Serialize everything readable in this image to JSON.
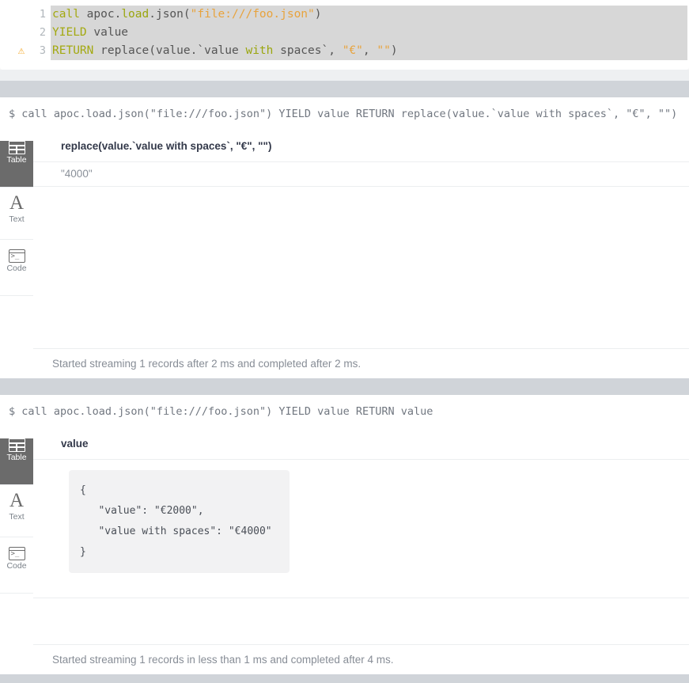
{
  "editor": {
    "lines": [
      {
        "number": "1",
        "warning": false,
        "tokens": [
          {
            "t": "call",
            "c": "kw"
          },
          {
            "t": " ",
            "c": "plain"
          },
          {
            "t": "apoc",
            "c": "plain"
          },
          {
            "t": ".",
            "c": "punct"
          },
          {
            "t": "load",
            "c": "kw2"
          },
          {
            "t": ".",
            "c": "punct"
          },
          {
            "t": "json",
            "c": "plain"
          },
          {
            "t": "(",
            "c": "punct"
          },
          {
            "t": "\"file:///foo.json\"",
            "c": "str"
          },
          {
            "t": ")",
            "c": "punct"
          }
        ]
      },
      {
        "number": "2",
        "warning": false,
        "tokens": [
          {
            "t": "YIELD",
            "c": "kw"
          },
          {
            "t": " value",
            "c": "plain"
          }
        ]
      },
      {
        "number": "3",
        "warning": true,
        "warning_icon": "warning-triangle-icon",
        "tokens": [
          {
            "t": "RETURN",
            "c": "kw"
          },
          {
            "t": " replace",
            "c": "plain"
          },
          {
            "t": "(",
            "c": "punct"
          },
          {
            "t": "value",
            "c": "plain"
          },
          {
            "t": ".",
            "c": "punct"
          },
          {
            "t": "`value ",
            "c": "plain"
          },
          {
            "t": "with",
            "c": "kw2"
          },
          {
            "t": " spaces`",
            "c": "plain"
          },
          {
            "t": ", ",
            "c": "punct"
          },
          {
            "t": "\"€\"",
            "c": "str"
          },
          {
            "t": ", ",
            "c": "punct"
          },
          {
            "t": "\"\"",
            "c": "str"
          },
          {
            "t": ")",
            "c": "punct"
          }
        ]
      }
    ]
  },
  "frames": [
    {
      "command": "$ call apoc.load.json(\"file:///foo.json\") YIELD value RETURN replace(value.`value with spaces`, \"€\", \"\")",
      "views": [
        {
          "label": "Table",
          "icon": "table-icon",
          "active": true
        },
        {
          "label": "Text",
          "icon": "text-icon",
          "active": false
        },
        {
          "label": "Code",
          "icon": "code-icon",
          "active": false
        }
      ],
      "result_type": "table",
      "columns": [
        "replace(value.`value with spaces`, \"€\", \"\")"
      ],
      "rows": [
        [
          "\"4000\""
        ]
      ],
      "status": "Started streaming 1 records after 2 ms and completed after 2 ms."
    },
    {
      "command": "$ call apoc.load.json(\"file:///foo.json\") YIELD value RETURN value",
      "views": [
        {
          "label": "Table",
          "icon": "table-icon",
          "active": true
        },
        {
          "label": "Text",
          "icon": "text-icon",
          "active": false
        },
        {
          "label": "Code",
          "icon": "code-icon",
          "active": false
        }
      ],
      "result_type": "json",
      "columns": [
        "value"
      ],
      "json_value": "{\n   \"value\": \"€2000\",\n   \"value with spaces\": \"€4000\"\n}",
      "status": "Started streaming 1 records in less than 1 ms and completed after 4 ms."
    }
  ],
  "colors": {
    "keyword": "#a3a911",
    "string": "#e8a33d",
    "warning": "#f5a623",
    "selection": "#d7d7d7",
    "band_gray": "#d0d4d9",
    "sidebar_active": "#6b6b6b"
  }
}
